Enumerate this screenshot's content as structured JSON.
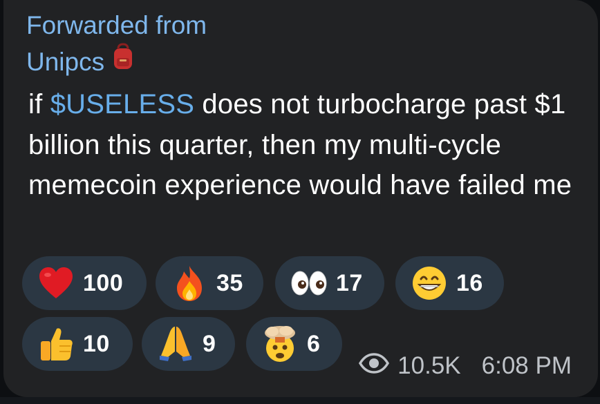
{
  "forward": {
    "label": "Forwarded from",
    "source": "Unipcs",
    "source_icon": "backpack-icon"
  },
  "message": {
    "prefix": "if ",
    "cashtag": "$USELESS",
    "body": " does not turbocharge past $1 billion this quarter, then my multi-cycle memecoin experience would have failed me"
  },
  "reactions": [
    {
      "emoji": "red-heart-icon",
      "count": "100"
    },
    {
      "emoji": "fire-icon",
      "count": "35"
    },
    {
      "emoji": "eyes-icon",
      "count": "17"
    },
    {
      "emoji": "grinning-face-icon",
      "count": "16"
    },
    {
      "emoji": "thumbs-up-icon",
      "count": "10"
    },
    {
      "emoji": "folded-hands-icon",
      "count": "9"
    },
    {
      "emoji": "exploding-head-icon",
      "count": "6"
    }
  ],
  "meta": {
    "views": "10.5K",
    "time": "6:08 PM",
    "views_icon": "eye-icon"
  },
  "colors": {
    "bubble": "#212224",
    "link": "#7fb7ec",
    "reaction_bg": "#2b3743",
    "text": "#ffffff",
    "meta_text": "#bfc3c8"
  }
}
